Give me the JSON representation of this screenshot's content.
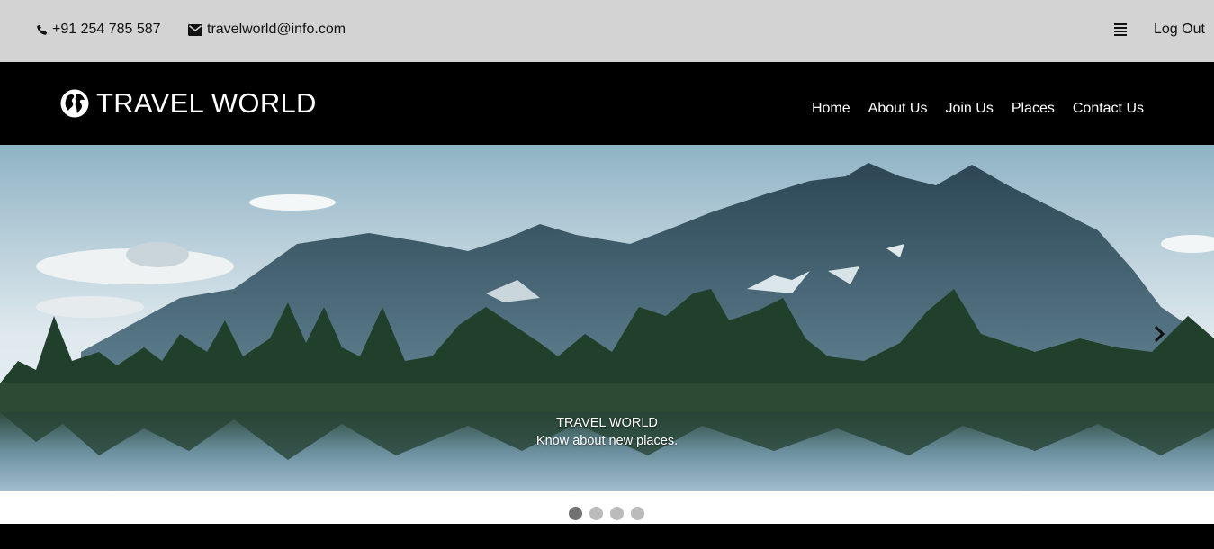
{
  "topbar": {
    "phone": "+91 254 785 587",
    "email": "travelworld@info.com",
    "menu_icon": "hamburger-icon",
    "logout_label": "Log Out"
  },
  "header": {
    "brand_name": "TRAVEL WORLD",
    "brand_icon": "globe-icon",
    "nav": [
      "Home",
      "About Us",
      "Join Us",
      "Places",
      "Contact Us"
    ]
  },
  "slideshow": {
    "caption_title": "TRAVEL WORLD",
    "caption_text": "Know about new places.",
    "next_icon": "chevron-right-icon",
    "slide_count": 4,
    "active_slide": 1
  },
  "colors": {
    "topbar_bg": "#d3d3d3",
    "navbar_bg": "#000000",
    "dot_active": "#717171",
    "dot_inactive": "#bbbbbb"
  }
}
